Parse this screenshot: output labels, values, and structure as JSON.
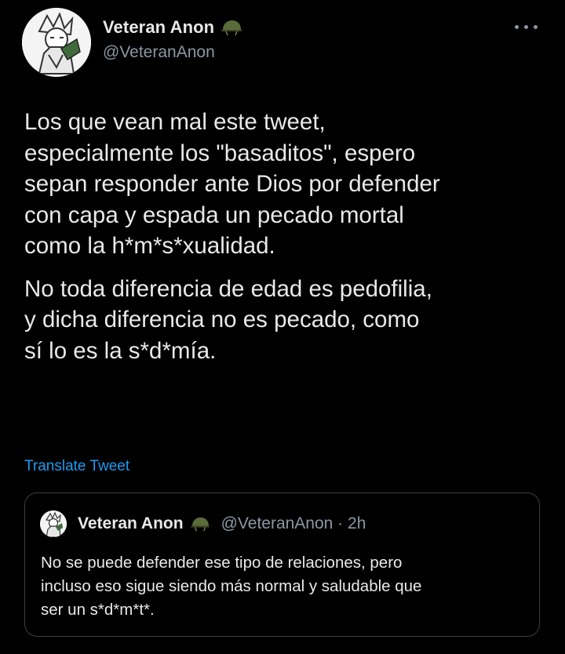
{
  "author": {
    "display_name": "Veteran Anon",
    "handle": "@VeteranAnon",
    "badge_icon": "helmet-icon",
    "avatar_icon": "anime-character-avatar"
  },
  "more_icon": "more-options-icon",
  "tweet": {
    "paragraph_1": "Los que vean mal este tweet,\nespecialmente los \"basaditos\", espero\nsepan responder ante Dios por defender\ncon capa y espada un pecado mortal\ncomo la h*m*s*xualidad.",
    "paragraph_2": "No toda diferencia de edad es pedofilia,\ny dicha diferencia no es pecado, como\nsí lo es la s*d*mía."
  },
  "translate_label": "Translate Tweet",
  "quoted_tweet": {
    "display_name": "Veteran Anon",
    "handle_time": "@VeteranAnon · 2h",
    "text": "No se puede defender ese tipo de relaciones, pero\nincluso eso sigue siendo más normal y saludable que\nser un s*d*m*t*."
  },
  "colors": {
    "background": "#000000",
    "text": "#e7e9ea",
    "secondary": "#8b98a5",
    "link": "#1d9bf0",
    "border": "#3a3f44"
  }
}
